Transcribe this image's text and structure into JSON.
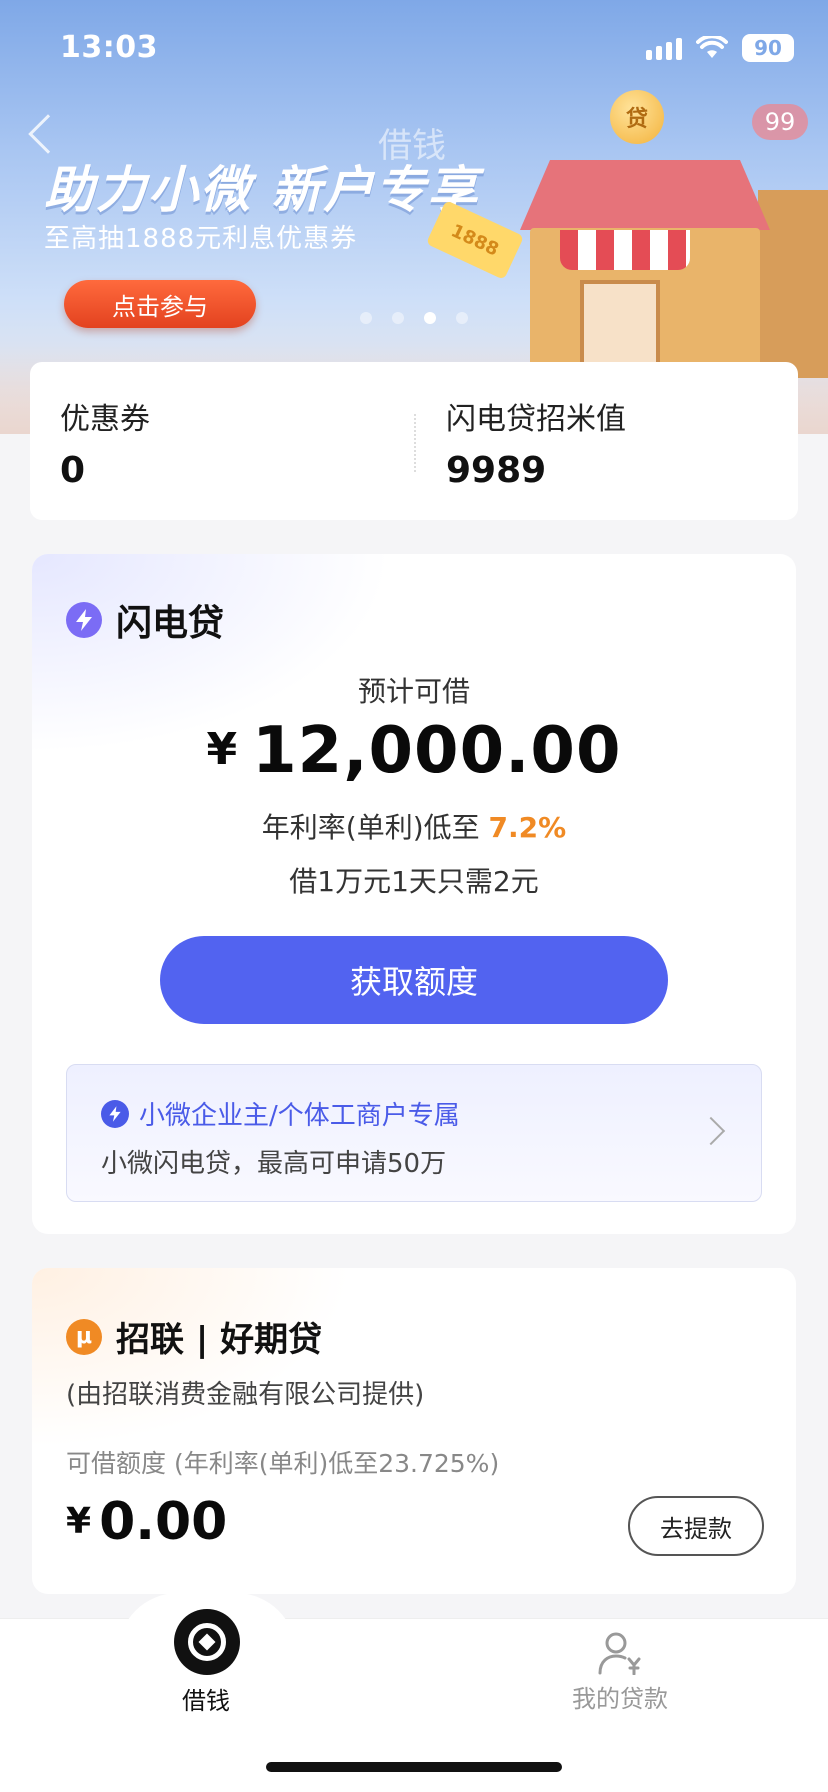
{
  "status": {
    "time": "13:03",
    "battery": "90"
  },
  "banner": {
    "ghost_title": "借钱",
    "badge": "99",
    "title": "助力小微 新户专享",
    "subtitle": "至高抽1888元利息优惠券",
    "cta": "点击参与",
    "coin": "贷",
    "ticket": "1888",
    "active_dot": 3,
    "dot_count": 4
  },
  "stats": {
    "coupons_label": "优惠券",
    "coupons_value": "0",
    "score_label": "闪电贷招米值",
    "score_value": "9989"
  },
  "loan": {
    "name": "闪电贷",
    "est_label": "预计可借",
    "currency": "¥",
    "amount": "12,000.00",
    "rate_prefix": "年利率(单利)低至",
    "rate_value": "7.2%",
    "daily": "借1万元1天只需2元",
    "button": "获取额度",
    "promo_title": "小微企业主/个体工商户专属",
    "promo_sub": "小微闪电贷，最高可申请50万"
  },
  "card2": {
    "icon_glyph": "μ",
    "name": "招联 | 好期贷",
    "provider": "(由招联消费金融有限公司提供)",
    "limit_label": "可借额度   (年利率(单利)低至23.725%)",
    "currency": "¥",
    "amount": "0.00",
    "button": "去提款"
  },
  "tabs": {
    "borrow": "借钱",
    "mine": "我的贷款"
  },
  "colors": {
    "accent": "#5263f0",
    "orange": "#f08a24",
    "bolt": "#7b6cf5"
  }
}
